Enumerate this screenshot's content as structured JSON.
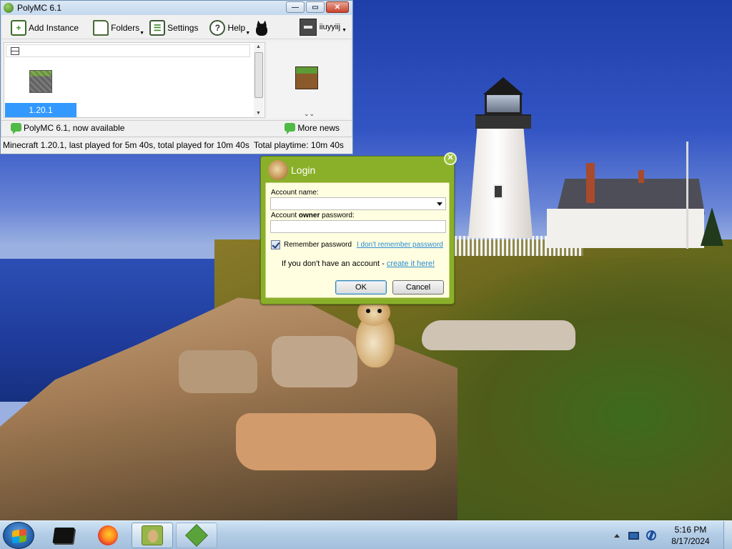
{
  "polymc_window": {
    "title": "PolyMC 6.1",
    "controls": {
      "minimize": "—",
      "maximize": "▭",
      "close": "✕"
    },
    "toolbar": {
      "add_instance": "Add Instance",
      "folders": "Folders",
      "settings": "Settings",
      "help": "Help",
      "account": "iiuyyiij"
    },
    "instances": [
      {
        "name": "1.20.1",
        "selected": true
      }
    ],
    "news_left": "PolyMC 6.1, now available",
    "news_right": "More news",
    "status": {
      "instance_info": "Minecraft 1.20.1, last played for 5m 40s, total played for 10m 40s",
      "total_playtime": "Total playtime: 10m 40s"
    }
  },
  "login_dialog": {
    "title": "Login",
    "close": "✕",
    "account_name_label": "Account name:",
    "password_label_prefix": "Account ",
    "password_label_bold": "owner",
    "password_label_suffix": " password:",
    "account_name_value": "",
    "password_value": "",
    "remember_label": "Remember password",
    "remember_checked": true,
    "forgot_link": "I don't remember password",
    "signup_text": "If you don't have an account - ",
    "signup_link": "create it here!",
    "ok": "OK",
    "cancel": "Cancel"
  },
  "taskbar": {
    "apps": [
      "terminal-icon",
      "firefox-icon",
      "hamster-app-icon",
      "minecraft-launcher-icon"
    ],
    "time": "5:16 PM",
    "date": "8/17/2024"
  },
  "colors": {
    "login_frame": "#8ab02a",
    "login_body": "#fffee0",
    "selection": "#3399ff",
    "link": "#2c8cd6"
  }
}
